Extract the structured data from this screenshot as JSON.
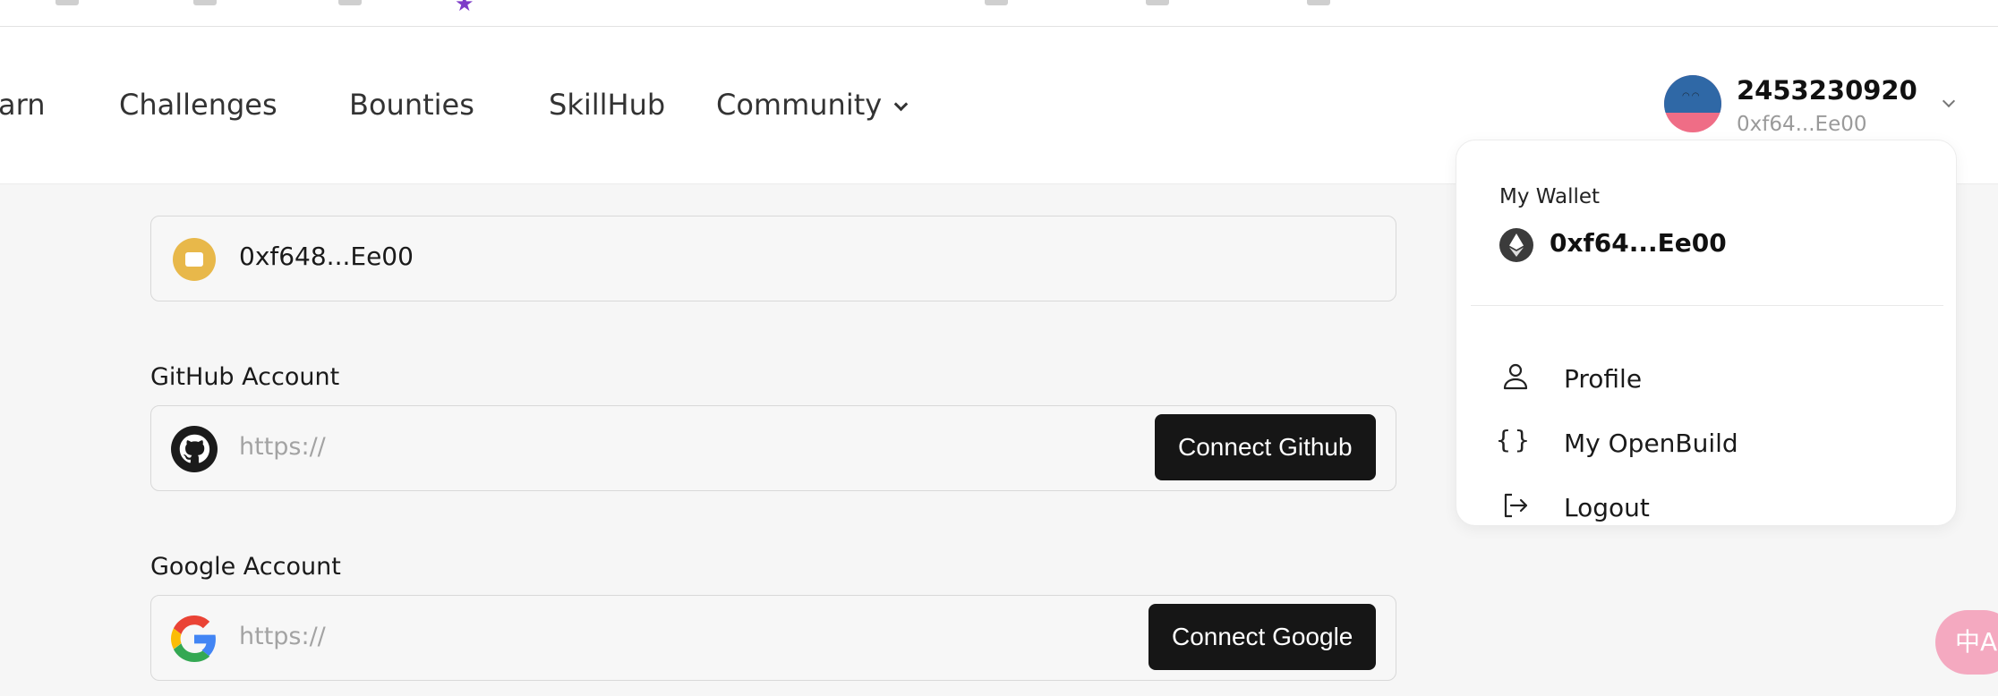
{
  "nav": {
    "learn_partial": "arn",
    "challenges": "Challenges",
    "bounties": "Bounties",
    "skillhub": "SkillHub",
    "community": "Community"
  },
  "user": {
    "name": "2453230920",
    "address_short": "0xf64...Ee00"
  },
  "wallet_field": {
    "address": "0xf648...Ee00"
  },
  "github": {
    "label": "GitHub Account",
    "placeholder": "https://",
    "button": "Connect Github"
  },
  "google": {
    "label": "Google Account",
    "placeholder": "https://",
    "button": "Connect Google"
  },
  "dropdown": {
    "wallet_label": "My Wallet",
    "wallet_address": "0xf64...Ee00",
    "items": [
      {
        "label": "Profile",
        "icon": "user-icon"
      },
      {
        "label": "My OpenBuild",
        "icon": "braces-icon"
      },
      {
        "label": "Logout",
        "icon": "logout-icon"
      }
    ]
  },
  "translate": {
    "label": "中A",
    "icon": "translate-icon"
  },
  "colors": {
    "button_dark": "#161616",
    "wallet_yellow": "#e8b84a",
    "translate_pink": "#f4a9c0",
    "bookmark_star": "#7d3cc8"
  }
}
